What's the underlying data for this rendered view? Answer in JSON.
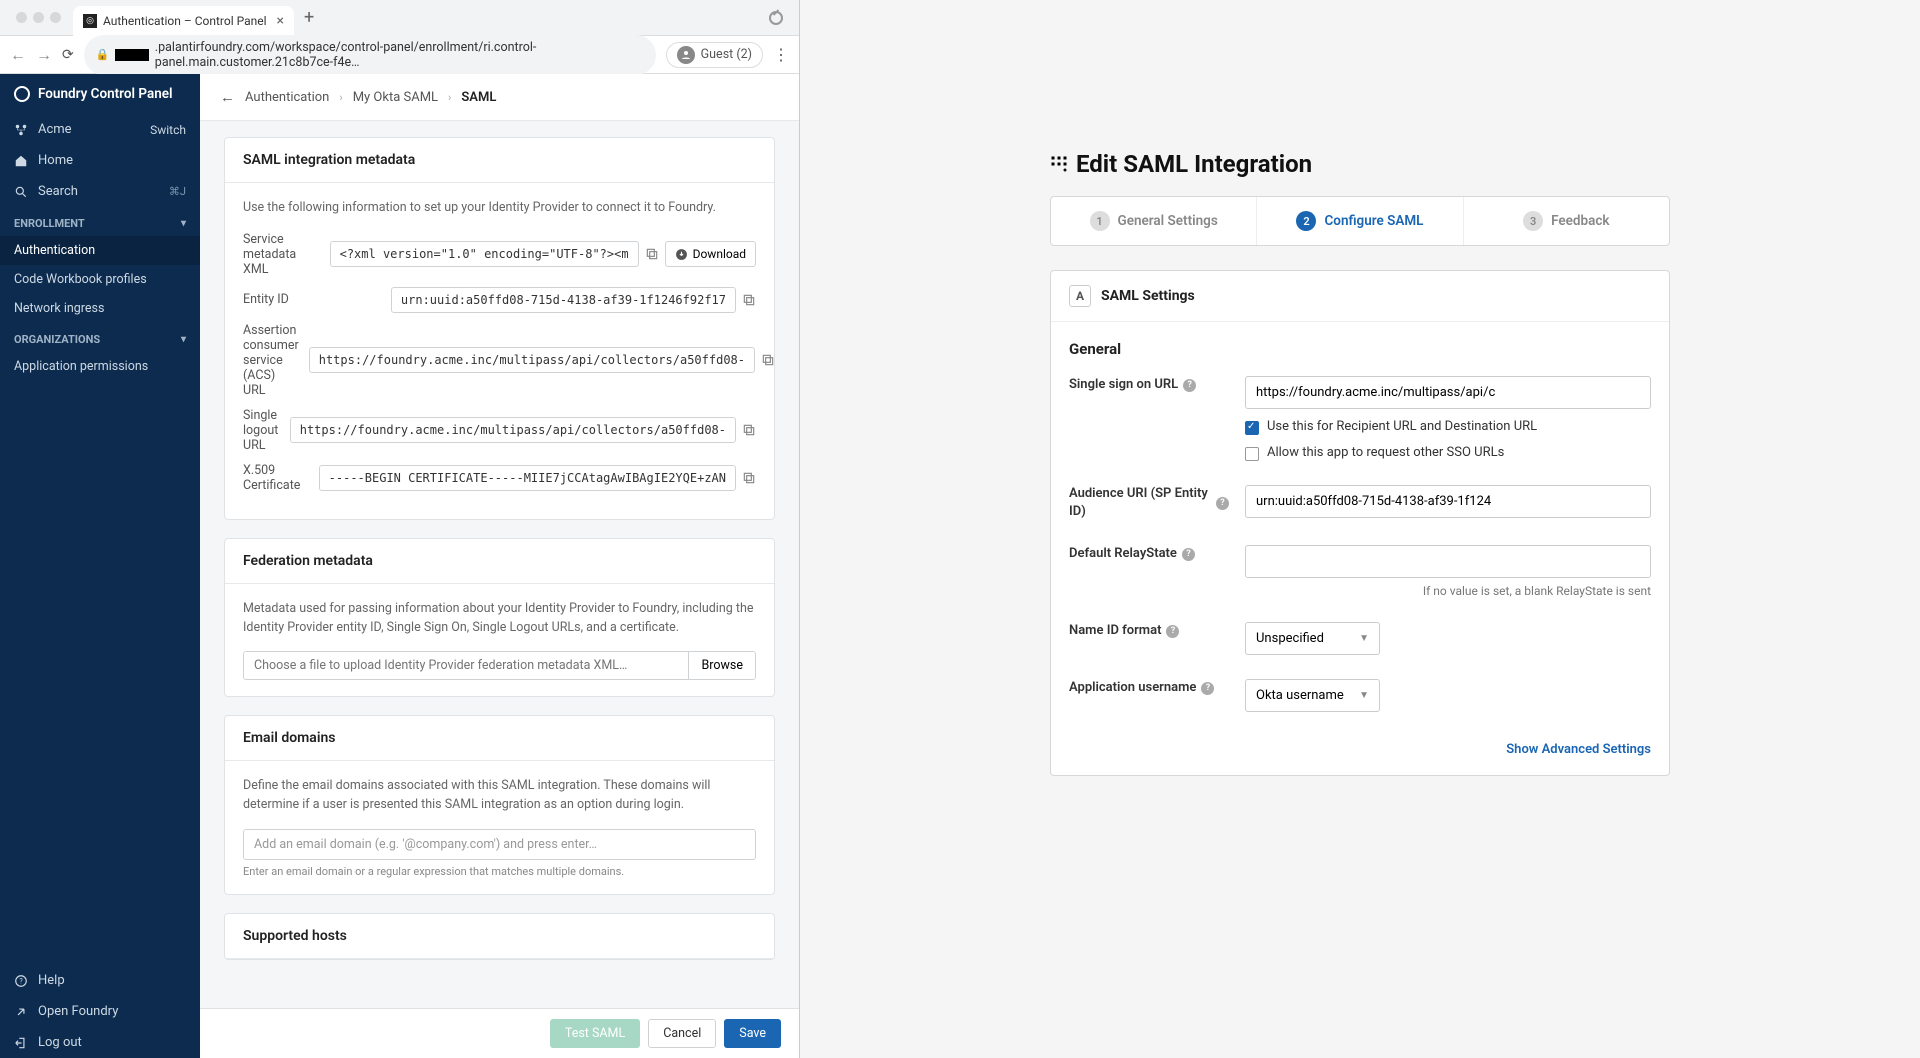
{
  "browser": {
    "tab_title": "Authentication – Control Panel",
    "address_domain": ".palantirfoundry.com/workspace/control-panel/enrollment/ri.control-panel.main.customer.21c8b7ce-f4e…",
    "guest_label": "Guest (2)"
  },
  "sidebar": {
    "product_title": "Foundry Control Panel",
    "org_name": "Acme",
    "switch_label": "Switch",
    "nav_home": "Home",
    "nav_search": "Search",
    "search_shortcut": "⌘J",
    "section_enrollment": "ENROLLMENT",
    "enrollment_items": [
      "Authentication",
      "Code Workbook profiles",
      "Network ingress"
    ],
    "section_orgs": "ORGANIZATIONS",
    "org_items": [
      "Application permissions"
    ],
    "footer_help": "Help",
    "footer_open": "Open Foundry",
    "footer_logout": "Log out"
  },
  "breadcrumb": {
    "crumb1": "Authentication",
    "crumb2": "My Okta SAML",
    "crumb3": "SAML"
  },
  "saml_card": {
    "title": "SAML integration metadata",
    "desc": "Use the following information to set up your Identity Provider to connect it to Foundry.",
    "download_label": "Download",
    "fields": {
      "svc_meta_label": "Service metadata XML",
      "svc_meta_value": "<?xml version=\"1.0\" encoding=\"UTF-8\"?><m",
      "entity_label": "Entity ID",
      "entity_value": "urn:uuid:a50ffd08-715d-4138-af39-1f1246f92f17",
      "acs_label": "Assertion consumer service (ACS) URL",
      "acs_value": "https://foundry.acme.inc/multipass/api/collectors/a50ffd08-",
      "slo_label": "Single logout URL",
      "slo_value": "https://foundry.acme.inc/multipass/api/collectors/a50ffd08-",
      "cert_label": "X.509 Certificate",
      "cert_value": "-----BEGIN CERTIFICATE-----MIIE7jCCAtagAwIBAgIE2YQE+zAN"
    }
  },
  "fed_card": {
    "title": "Federation metadata",
    "desc": "Metadata used for passing information about your Identity Provider to Foundry, including the Identity Provider entity ID, Single Sign On, Single Logout URLs, and a certificate.",
    "placeholder": "Choose a file to upload Identity Provider federation metadata XML…",
    "browse": "Browse"
  },
  "email_card": {
    "title": "Email domains",
    "desc": "Define the email domains associated with this SAML integration. These domains will determine if a user is presented this SAML integration as an option during login.",
    "placeholder": "Add an email domain (e.g. '@company.com') and press enter…",
    "helper": "Enter an email domain or a regular expression that matches multiple domains."
  },
  "hosts_card": {
    "title": "Supported hosts"
  },
  "footer": {
    "test": "Test SAML",
    "cancel": "Cancel",
    "save": "Save"
  },
  "okta": {
    "title": "Edit SAML Integration",
    "step1": "General Settings",
    "step2": "Configure SAML",
    "step3": "Feedback",
    "card_badge": "A",
    "card_title": "SAML Settings",
    "subhead": "General",
    "sso_label": "Single sign on URL",
    "sso_value": "https://foundry.acme.inc/multipass/api/c",
    "chk1": "Use this for Recipient URL and Destination URL",
    "chk2": "Allow this app to request other SSO URLs",
    "audience_label": "Audience URI (SP Entity ID)",
    "audience_value": "urn:uuid:a50ffd08-715d-4138-af39-1f124",
    "relay_label": "Default RelayState",
    "relay_helper": "If no value is set, a blank RelayState is sent",
    "nameid_label": "Name ID format",
    "nameid_value": "Unspecified",
    "appuser_label": "Application username",
    "appuser_value": "Okta username",
    "advanced": "Show Advanced Settings"
  }
}
